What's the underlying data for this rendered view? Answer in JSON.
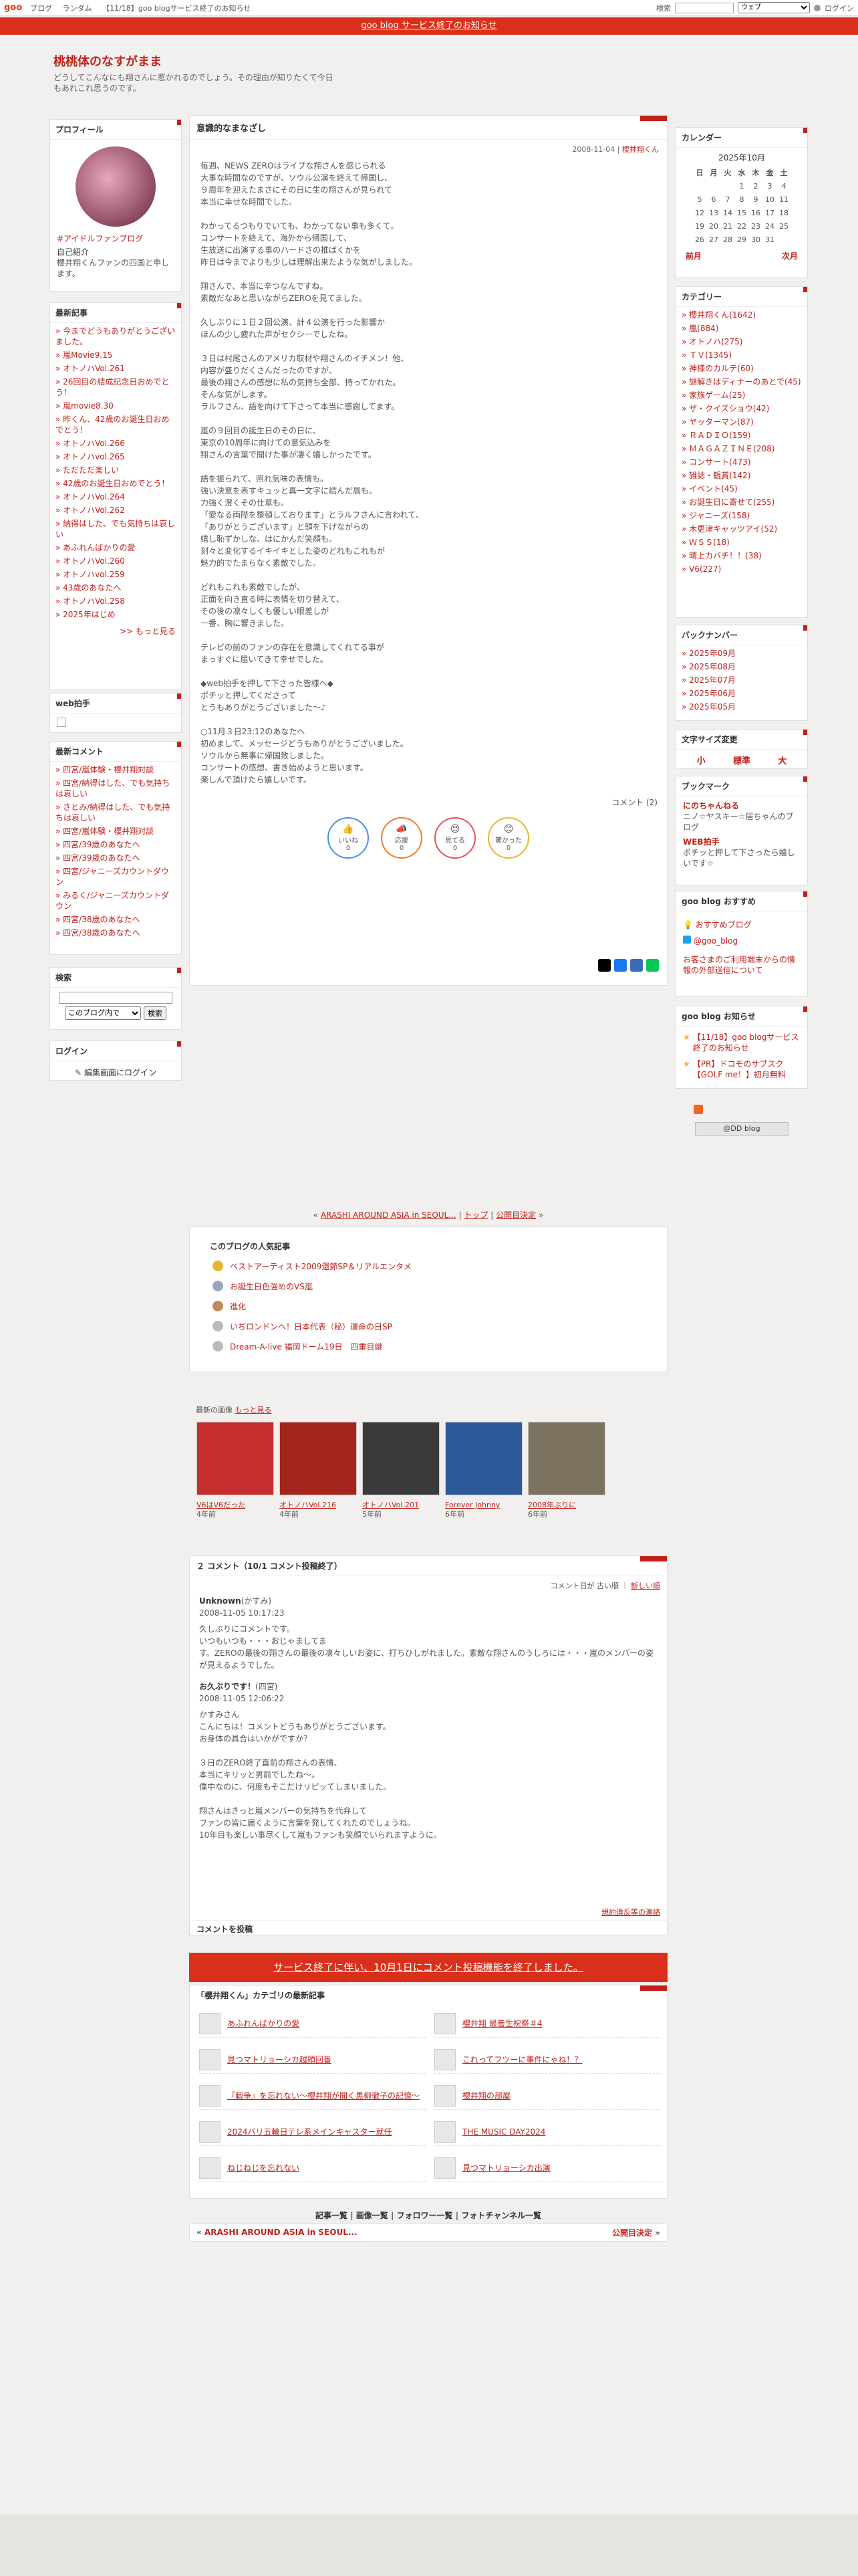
{
  "topbar": {
    "logo": "goo",
    "nav": [
      "ブログ",
      "ランダム",
      "【11/18】goo blogサービス終了のお知らせ"
    ],
    "search_label": "検索",
    "scope": "ウェブ",
    "login": "ログイン"
  },
  "announce": "goo blog サービス終了のお知らせ",
  "blog": {
    "title": "桃桃体のなすがまま",
    "desc": "どうしてこんなにも翔さんに惹かれるのでしょう。その理由が知りたくて今日もあれこれ思うのです。"
  },
  "profile": {
    "title": "プロフィール",
    "tag": "#アイドルファンブログ",
    "intro_label": "自己紹介",
    "intro": "櫻井翔くんファンの四国と申します。"
  },
  "recent": {
    "title": "最新記事",
    "items": [
      "今までどうもありがとうございました。",
      "嵐Movie9.15",
      "オトノハVol.261",
      "26回目の結成記念日おめでとう！",
      "嵐movie8.30",
      "昨くん、42歳のお誕生日おめでとう！",
      "オトノハVol.266",
      "オトノハvol.265",
      "ただただ楽しい",
      "42歳のお誕生日おめでとう！",
      "オトノハVol.264",
      "オトノハVol.262",
      "納得はした、でも気持ちは哀しい",
      "あふれんばかりの愛",
      "オトノハVol.260",
      "オトノハvol.259",
      "43歳のあなたへ",
      "オトノハVol.258",
      "2025年はじめ"
    ],
    "more": ">> もっと見る"
  },
  "web_clap": {
    "title": "web拍手"
  },
  "recent_comments": {
    "title": "最新コメント",
    "items": [
      "四宮/嵐体験・櫻井翔対談",
      "四宮/納得はした、でも気持ちは哀しい",
      "さとみ/納得はした、でも気持ちは哀しい",
      "四宮/嵐体験・櫻井翔対談",
      "四宮/39歳のあなたへ",
      "四宮/39歳のあなたへ",
      "四宮/ジャニーズカウントダウン",
      "みるく/ジャニーズカウントダウン",
      "四宮/38歳のあなたへ",
      "四宮/38歳のあなたへ"
    ]
  },
  "search": {
    "title": "検索",
    "scope": "このブログ内で",
    "button": "検索"
  },
  "login": {
    "title": "ログイン",
    "link": "編集画面にログイン"
  },
  "article": {
    "title": "意識的なまなざし",
    "date": "2008-11-04",
    "author": "櫻井翔くん",
    "body": [
      "毎週、NEWS ZEROはライブな翔さんを感じられる",
      "大事な時間なのですが、ソウル公演を終えて帰国し、",
      "９周年を迎えたまさにその日に生の翔さんが見られて",
      "本当に幸せな時間でした。",
      "",
      "わかってるつもりでいても、わかってない事も多くて。",
      "コンサートを終えて、海外から帰国して、",
      "生放送に出演する事のハードさの推ばくかを",
      "昨日は今までよりも少しは理解出来たような気がしました。",
      "",
      "翔さんで、本当に辛つなんですね。",
      "素敵だなあと思いながらZEROを見てました。",
      "",
      "久しぶりに１日２回公演、計４公演を行った影響か",
      "ほんの少し疲れた声がセクシーでしたね。",
      "",
      "３日は村尾さんのアメリカ取材や翔さんのイチメン！他、",
      "内容が盛りだくさんだったのですが、",
      "最後の翔さんの感想に私の気持ち全部、持ってかれた。",
      "そんな気がします。",
      "ラルフさん、語を向けて下さって本当に感謝してます。",
      "",
      "嵐の９回目の誕生日のその日に、",
      "東京の10周年に向けての意気込みを",
      "翔さんの言葉で聞けた事が凄く嬉しかったです。",
      "",
      "語を振られて、照れ気味の表情も。",
      "強い決意を表すキュッと真一文字に結んだ唇も。",
      "力強く澄くその仕草も。",
      "「愛なる両陛を整頓しております」とラルフさんに言われて、",
      "「ありがとうございます」と頭を下げながらの",
      "嬉し恥ずかしな、はにかんだ笑顔も。",
      "刻々と変化するイキイキとした姿のどれもこれもが",
      "魅力的でたまらなく素敵でした。",
      "",
      "どれもこれも素敵でしたが、",
      "正面を向き直る時に表情を切り替えて、",
      "その後の凛々しくも優しい眼差しが",
      "一番、胸に響きました。",
      "",
      "テレビの前のファンの存在を意識してくれてる事が",
      "まっすぐに届いてきて幸せでした。",
      "",
      "◆web拍手を押して下さった皆様へ◆",
      "ポチッと押してくださって",
      "とうもありがとうございました～♪",
      "",
      "○11月３日23:12のあなたへ",
      "初めまして、メッセージどうもありがとうございました。",
      "ソウルから無事に帰国致しました。",
      "コンサートの感想、書き始めようと思います。",
      "楽しんで頂けたら嬉しいです。"
    ],
    "comments_label": "コメント (2)",
    "reactions": [
      {
        "label": "いいね",
        "n": "0",
        "color": "#4a8ede",
        "icon": "👍"
      },
      {
        "label": "応援",
        "n": "0",
        "color": "#ec7f2a",
        "icon": "📣"
      },
      {
        "label": "見てる",
        "n": "0",
        "color": "#e7505a",
        "icon": "😍"
      },
      {
        "label": "驚かった",
        "n": "0",
        "color": "#e8b531",
        "icon": "😊"
      }
    ],
    "share_colors": [
      "#000000",
      "#1877f2",
      "#3b6cb5",
      "#06c755"
    ]
  },
  "calendar": {
    "title": "カレンダー",
    "month": "2025年10月",
    "days_header": [
      "日",
      "月",
      "火",
      "水",
      "木",
      "金",
      "土"
    ],
    "weeks": [
      [
        "",
        "",
        "",
        "1",
        "2",
        "3",
        "4"
      ],
      [
        "5",
        "6",
        "7",
        "8",
        "9",
        "10",
        "11"
      ],
      [
        "12",
        "13",
        "14",
        "15",
        "16",
        "17",
        "18"
      ],
      [
        "19",
        "20",
        "21",
        "22",
        "23",
        "24",
        "25"
      ],
      [
        "26",
        "27",
        "28",
        "29",
        "30",
        "31",
        ""
      ]
    ],
    "prev": "前月",
    "next": "次月"
  },
  "categories": {
    "title": "カテゴリー",
    "items": [
      "櫻井翔くん(1642)",
      "嵐(884)",
      "オトノハ(275)",
      "ＴＶ(1345)",
      "神様のカルテ(60)",
      "謎解きはディナーのあとで(45)",
      "家族ゲーム(25)",
      "ザ・クイズショウ(42)",
      "ヤッターマン(87)",
      "ＲＡＤＩＯ(159)",
      "ＭＡＧＡＺＩＮＥ(208)",
      "コンサート(473)",
      "雑誌・観賞(142)",
      "イベント(45)",
      "お誕生日に寄せて(255)",
      "ジャニーズ(158)",
      "木更津キャッツアイ(52)",
      "ＷＳＳ(18)",
      "晴上カバチ！！(38)",
      "V6(227)"
    ]
  },
  "archive": {
    "title": "バックナンバー",
    "items": [
      "2025年09月",
      "2025年08月",
      "2025年07月",
      "2025年06月",
      "2025年05月"
    ]
  },
  "fontsize": {
    "title": "文字サイズ変更",
    "small": "小",
    "normal": "標準",
    "large": "大"
  },
  "bookmark": {
    "title": "ブックマーク",
    "items": [
      {
        "name": "にのちゃんねる",
        "desc": "ニノ☆ヤスキー☆居ちゃんのブログ"
      },
      {
        "name": "WEB拍手",
        "desc": "ポチッと押して下さったら嬉しいです☆"
      }
    ]
  },
  "goo_rec": {
    "title": "goo blog おすすめ",
    "items": [
      "おすすめブログ",
      "@goo_blog"
    ],
    "link": "お客さまのご利用端末からの情報の外部送信について"
  },
  "goo_news": {
    "title": "goo blog お知らせ",
    "items": [
      "【11/18】goo blogサービス終了のお知らせ",
      "【PR】ドコモのサブスク【GOLF me！】初月無料"
    ]
  },
  "footer_badge": "@DD blog",
  "pager": {
    "prev": "ARASHI AROUND ASIA in SEOUL...",
    "top": "トップ",
    "next": "公開目決定"
  },
  "popular": {
    "title": "このブログの人気記事",
    "items": [
      "ベストアーティスト2009還節SP＆リアルエンタメ",
      "お誕生日色強めのVS嵐",
      "進化",
      "いぢロンドンへ！日本代表（秘）運命の日SP",
      "Dream-A-live 福岡ドーム19日　四重目継"
    ]
  },
  "images": {
    "title": "最新の画像",
    "more": "もっと見る",
    "items": [
      {
        "name": "V6はV6だった",
        "age": "4年前",
        "color": "#c52e2e"
      },
      {
        "name": "オトノハVol.216",
        "age": "4年前",
        "color": "#a5241c"
      },
      {
        "name": "オトノハVol.201",
        "age": "5年前",
        "color": "#3a3a3a"
      },
      {
        "name": "Forever Johnny",
        "age": "6年前",
        "color": "#2d5a9b"
      },
      {
        "name": "2008年ぶりに",
        "age": "6年前",
        "color": "#7c7260"
      }
    ]
  },
  "comments": {
    "title": "２ コメント（10/1 コメント投稿終了）",
    "sort": "コメント日が 古い順 ｜",
    "sort_link": "新しい順",
    "items": [
      {
        "name": "Unknown",
        "handle": "(かすみ)",
        "date": "2008-11-05 10:17:23",
        "lines": [
          "久しぶりにコメントです。",
          "いつもいつも・・・おじゃましてま",
          "す。ZEROの最後の翔さんの最後の凛々しいお姿に、打ちひしがれました。素敵な翔さんのうしろには・・・嵐のメンバーの姿が見えるようでした。"
        ]
      },
      {
        "name": "お久ぶりです！",
        "handle": "(四宮)",
        "date": "2008-11-05 12:06:22",
        "lines": [
          "かすみさん",
          "こんにちは！コメントどうもありがとうございます。",
          "お身体の具合はいかがですか？",
          "",
          "３日のZERO終了直前の翔さんの表情、",
          "本当にキリッと男前でしたね～。",
          "僕中なのに、何度もそこだけリピッてしまいました。",
          "",
          "翔さんはきっと嵐メンバーの気持ちを代弁して",
          "ファンの皆に届くように言葉を発してくれたのでしょうね。",
          "10年目も楽しい事尽くして嵐もファンも笑顔でいられますように。"
        ]
      }
    ],
    "report": "規約違反等の連絡"
  },
  "post": {
    "title": "コメントを投稿",
    "notice": "サービス終了に伴い、10月1日にコメント投稿機能を終了しました。"
  },
  "category_latest": {
    "title": "「櫻井翔くん」カテゴリの最新記事",
    "items": [
      "あふれんばかりの愛",
      "見つマトリョーシカ越頭回番",
      "『戦争』を忘れない〜櫻井翔が聞く黒柳徹子の記憶〜",
      "2024バリ五輪日テレ系メインキャスター就任",
      "ねじねじを忘れない",
      "櫻井翔 最善生祝祭＃4",
      "これってフツーに事件にゃね！？",
      "櫻井翔の部屋",
      "THE MUSIC DAY2024",
      "見つマトリョーシカ出演"
    ]
  },
  "footer_links": [
    "記事一覧",
    "画像一覧",
    "フォロワー一覧",
    "フォトチャンネル一覧"
  ],
  "footer_pager": {
    "prev": "ARASHI AROUND ASIA in SEOUL...",
    "next": "公開目決定"
  }
}
